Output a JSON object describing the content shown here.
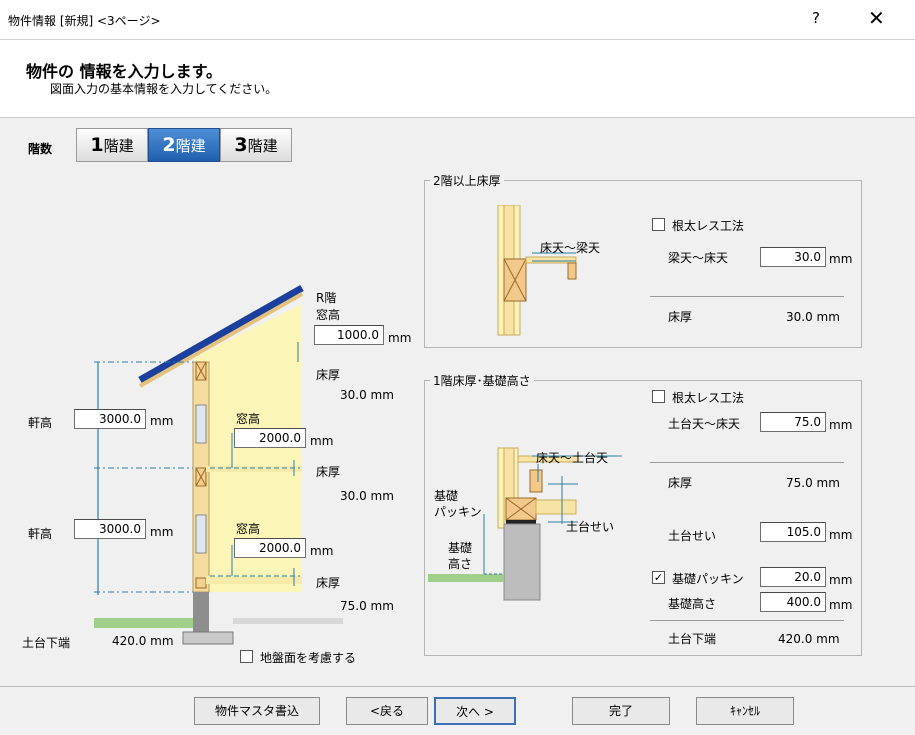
{
  "window": {
    "title": "物件情報 [新規] <3ページ>",
    "help": "?",
    "close": "✕"
  },
  "header": {
    "heading": "物件の 情報を入力します。",
    "subheading": "図面入力の基本情報を入力してください。"
  },
  "floors": {
    "label": "階数",
    "options": [
      {
        "num": "1",
        "suffix": "階建"
      },
      {
        "num": "2",
        "suffix": "階建"
      },
      {
        "num": "3",
        "suffix": "階建"
      }
    ]
  },
  "left": {
    "r_floor_label": "R階",
    "window_height_label": "窓高",
    "r_window_height": "1000.0",
    "unit": "mm",
    "eaves_label": "軒高",
    "floor_thickness_label": "床厚",
    "eaves_2": "3000.0",
    "eaves_1": "3000.0",
    "window_2": "2000.0",
    "window_1": "2000.0",
    "floor_thick_r": "30.0 mm",
    "floor_thick_2": "30.0 mm",
    "floor_thick_1": "75.0 mm",
    "sill_bottom_label": "土台下端",
    "sill_bottom_value": "420.0 mm",
    "ground_check_label": "地盤面を考慮する"
  },
  "upper_group": {
    "title": "2階以上床厚",
    "diagram_label": "床天～梁天",
    "joistless_label": "根太レス工法",
    "joistless_checked": false,
    "beam_label": "梁天～床天",
    "beam_value": "30.0",
    "unit": "mm",
    "floor_thick_label": "床厚",
    "floor_thick_value": "30.0 mm"
  },
  "lower_group": {
    "title": "1階床厚･基礎高さ",
    "diagram_floor_label": "床天～土台天",
    "diagram_packing_label": "基礎\nパッキン",
    "diagram_sill_label": "土台せい",
    "diagram_foundation_label": "基礎\n高さ",
    "joistless_label": "根太レス工法",
    "joistless_checked": false,
    "sill_top_label": "土台天～床天",
    "sill_top_value": "75.0",
    "unit": "mm",
    "floor_thick_label": "床厚",
    "floor_thick_value": "75.0 mm",
    "sill_height_label": "土台せい",
    "sill_height_value": "105.0",
    "packing_label": "基礎パッキン",
    "packing_checked": true,
    "packing_value": "20.0",
    "foundation_label": "基礎高さ",
    "foundation_value": "400.0",
    "sill_bottom_label": "土台下端",
    "sill_bottom_value": "420.0 mm"
  },
  "footer": {
    "master_write": "物件マスタ書込",
    "back": "<戻る",
    "next": "次へ >",
    "finish": "完了",
    "cancel": "ｷｬﾝｾﾙ"
  }
}
